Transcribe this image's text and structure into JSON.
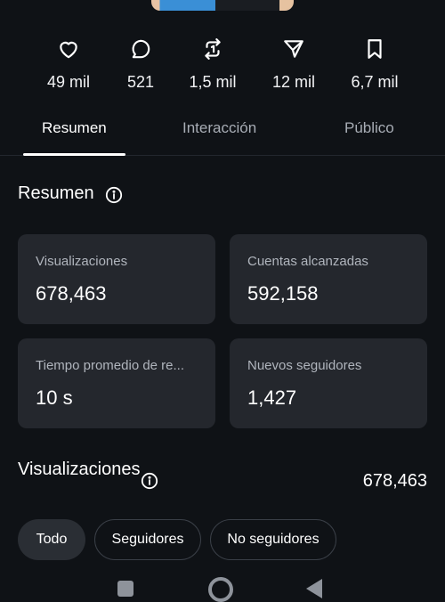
{
  "stats": [
    {
      "icon": "heart-icon",
      "value": "49 mil"
    },
    {
      "icon": "comment-icon",
      "value": "521"
    },
    {
      "icon": "repost-icon",
      "value": "1,5 mil"
    },
    {
      "icon": "share-icon",
      "value": "12 mil"
    },
    {
      "icon": "bookmark-icon",
      "value": "6,7 mil"
    }
  ],
  "tabs": [
    "Resumen",
    "Interacción",
    "Público"
  ],
  "summary": {
    "title": "Resumen",
    "cards": [
      {
        "label": "Visualizaciones",
        "value": "678,463"
      },
      {
        "label": "Cuentas alcanzadas",
        "value": "592,158"
      },
      {
        "label": "Tiempo promedio de re...",
        "value": "10 s"
      },
      {
        "label": "Nuevos seguidores",
        "value": "1,427"
      }
    ]
  },
  "views": {
    "title": "Visualizaciones",
    "total": "678,463",
    "filters": [
      "Todo",
      "Seguidores",
      "No seguidores"
    ]
  },
  "colors": {
    "background": "#0f1216",
    "card": "#24272d",
    "muted_text": "#b0b5bd"
  }
}
